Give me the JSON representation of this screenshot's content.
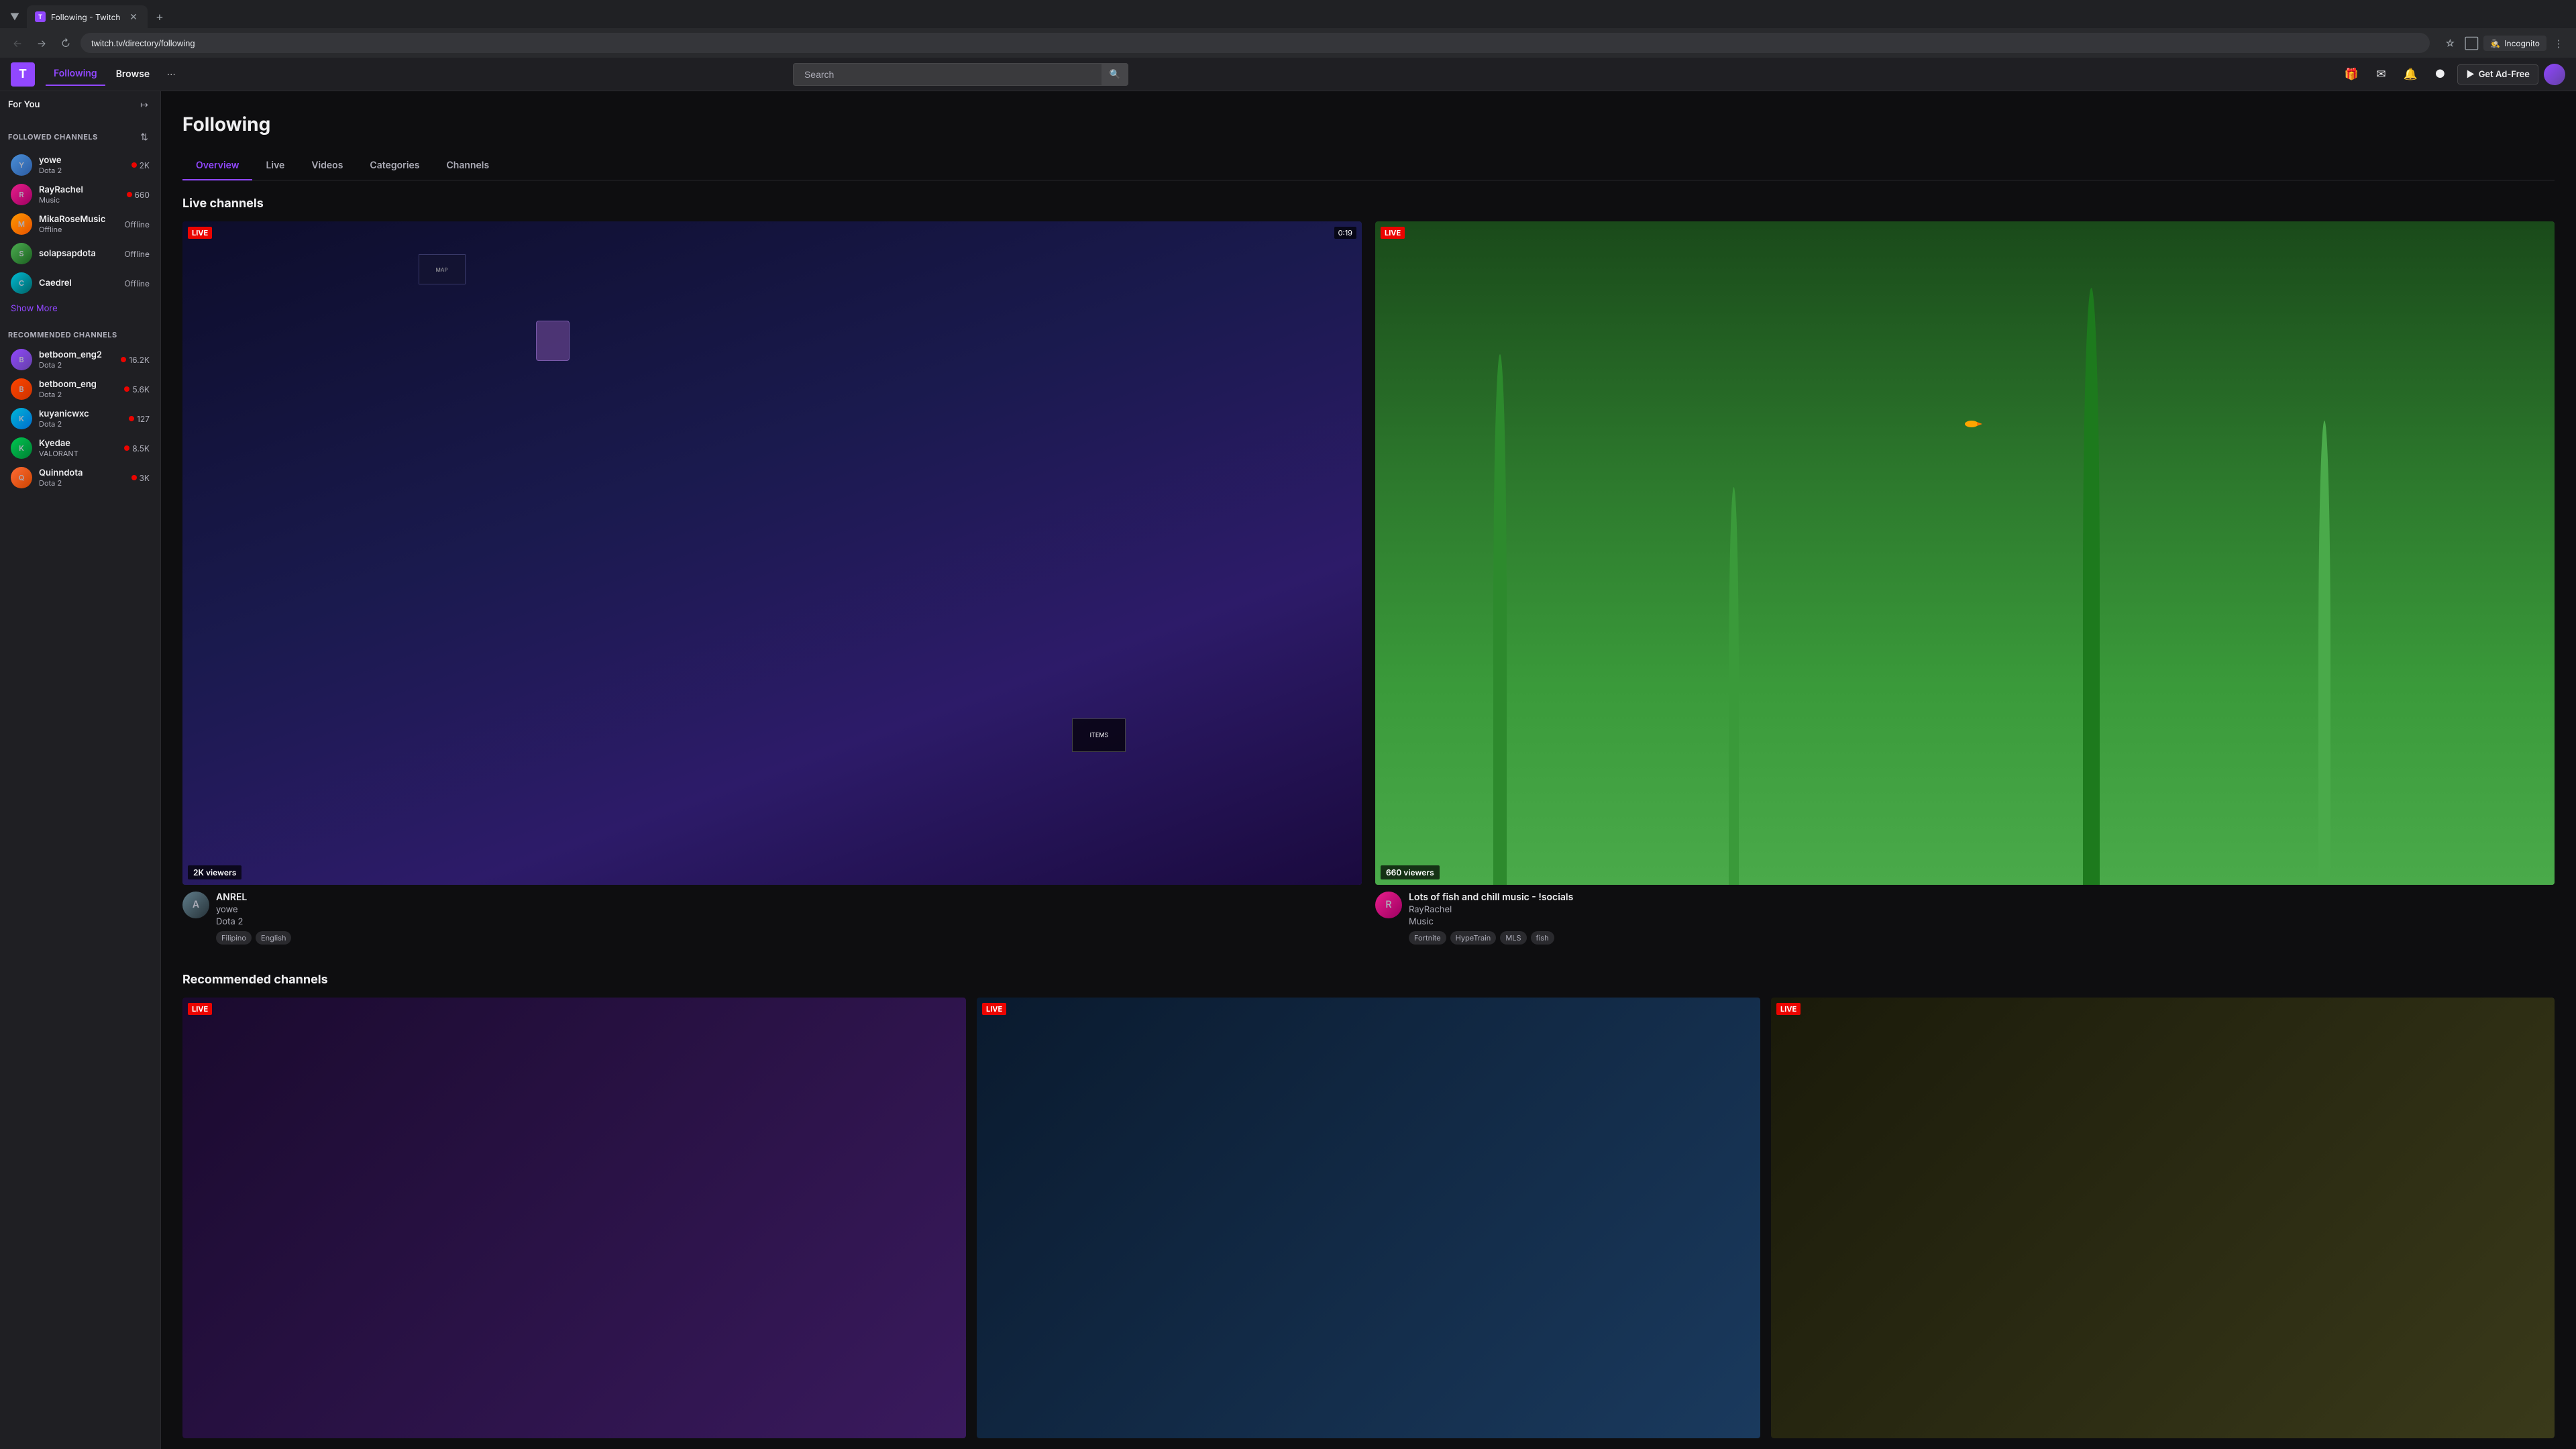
{
  "browser": {
    "tab_title": "Following - Twitch",
    "tab_favicon": "T",
    "address": "twitch.tv/directory/following",
    "new_tab_label": "+",
    "incognito_label": "Incognito"
  },
  "nav": {
    "logo": "T",
    "following_label": "Following",
    "browse_label": "Browse",
    "search_placeholder": "Search",
    "get_ad_free_label": "Get Ad-Free"
  },
  "sidebar": {
    "for_you_label": "For You",
    "followed_channels_label": "FOLLOWED CHANNELS",
    "show_more_label": "Show More",
    "recommended_channels_label": "RECOMMENDED CHANNELS",
    "followed": [
      {
        "name": "yowe",
        "game": "Dota 2",
        "viewers": "2K",
        "live": true,
        "initials": "Y"
      },
      {
        "name": "RayRachel",
        "game": "Music",
        "viewers": "660",
        "live": true,
        "initials": "R"
      },
      {
        "name": "MikaRoseMusic",
        "game": "Offline",
        "viewers": "",
        "live": false,
        "initials": "M"
      },
      {
        "name": "solapsapdota",
        "game": "Offline",
        "viewers": "",
        "live": false,
        "initials": "S"
      },
      {
        "name": "Caedrel",
        "game": "Offline",
        "viewers": "",
        "live": false,
        "initials": "C"
      }
    ],
    "recommended": [
      {
        "name": "betboom_eng2",
        "game": "Dota 2",
        "viewers": "16.2K",
        "live": true,
        "initials": "B"
      },
      {
        "name": "betboom_eng",
        "game": "Dota 2",
        "viewers": "5.6K",
        "live": true,
        "initials": "B"
      },
      {
        "name": "kuyanicwxc",
        "game": "Dota 2",
        "viewers": "127",
        "live": true,
        "initials": "K"
      },
      {
        "name": "Kyedae",
        "game": "VALORANT",
        "viewers": "8.5K",
        "live": true,
        "initials": "K"
      },
      {
        "name": "Quinndota",
        "game": "Dota 2",
        "viewers": "3K",
        "live": true,
        "initials": "Q"
      }
    ]
  },
  "content": {
    "page_title": "Following",
    "tabs": [
      "Overview",
      "Live",
      "Videos",
      "Categories",
      "Channels"
    ],
    "active_tab": "Overview",
    "live_channels_title": "Live channels",
    "streams": [
      {
        "streamer": "ANREL",
        "channel": "yowe",
        "game": "Dota 2",
        "title": "ANREL",
        "viewers": "2K viewers",
        "timer": "0:19",
        "tags": [
          "Filipino",
          "English"
        ],
        "initials": "A"
      },
      {
        "streamer": "Lots of fish and chill music - !socials",
        "channel": "RayRachel",
        "game": "Music",
        "title": "Lots of fish and chill music - !socials",
        "viewers": "660 viewers",
        "timer": "",
        "tags": [
          "Fortnite",
          "HypeTrain",
          "MLS",
          "fish"
        ],
        "initials": "R"
      }
    ],
    "recommended_title": "Recommended channels"
  }
}
